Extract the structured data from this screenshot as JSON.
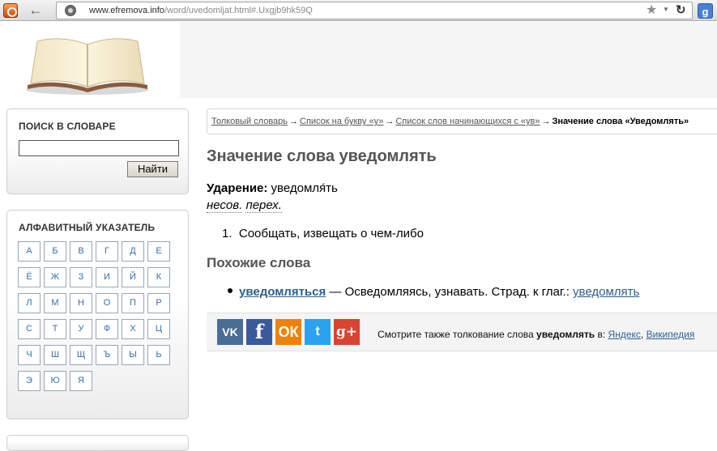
{
  "browser": {
    "back_glyph": "←",
    "url_host": "www.efremova.info",
    "url_path": "/word/uvedomljat.html#.Uxgjb9hk59Q",
    "star_glyph": "★",
    "dropdown_glyph": "▼",
    "reload_glyph": "↻",
    "google_glyph": "g"
  },
  "sidebar": {
    "search": {
      "title": "ПОИСК В СЛОВАРЕ",
      "input_value": "",
      "button_label": "Найти"
    },
    "alphabet": {
      "title": "АЛФАВИТНЫЙ УКАЗАТЕЛЬ",
      "letters": [
        "А",
        "Б",
        "В",
        "Г",
        "Д",
        "Е",
        "Ё",
        "Ж",
        "З",
        "И",
        "Й",
        "К",
        "Л",
        "М",
        "Н",
        "О",
        "П",
        "Р",
        "С",
        "Т",
        "У",
        "Ф",
        "Х",
        "Ц",
        "Ч",
        "Ш",
        "Щ",
        "Ъ",
        "Ы",
        "Ь",
        "Э",
        "Ю",
        "Я"
      ]
    }
  },
  "breadcrumb": {
    "items": [
      "Толковый словарь",
      "Список на букву «у»",
      "Список слов начинающихся с «ув»"
    ],
    "separator": "→",
    "current": "Значение слова «Уведомлять»"
  },
  "article": {
    "title": "Значение слова уведомлять",
    "stress_label": "Ударение:",
    "stress_value": "уведомля́ть",
    "pos_aspect": "несов.",
    "pos_transitivity": "перех.",
    "definition_number": "1.",
    "definition": "Сообщать, извещать о чем-либо",
    "similar_title": "Похожие слова",
    "similar": {
      "word": "уведомляться",
      "description": " — Осведомляясь, узнавать. Страд. к глаг.: ",
      "ref": "уведомлять"
    }
  },
  "share": {
    "icons": [
      "vk-icon",
      "facebook-icon",
      "odnoklassniki-icon",
      "twitter-icon",
      "google-plus-icon"
    ],
    "vk_glyph": "VK",
    "fb_glyph": "f",
    "ok_glyph": "ОК",
    "tw_glyph": "t",
    "gp_glyph": "g+",
    "text_prefix": "Смотрите также толкование слова ",
    "word": "уведомлять",
    "text_in": " в: ",
    "link_yandex": "Яндекс",
    "comma": ", ",
    "link_wiki": "Википедия"
  }
}
